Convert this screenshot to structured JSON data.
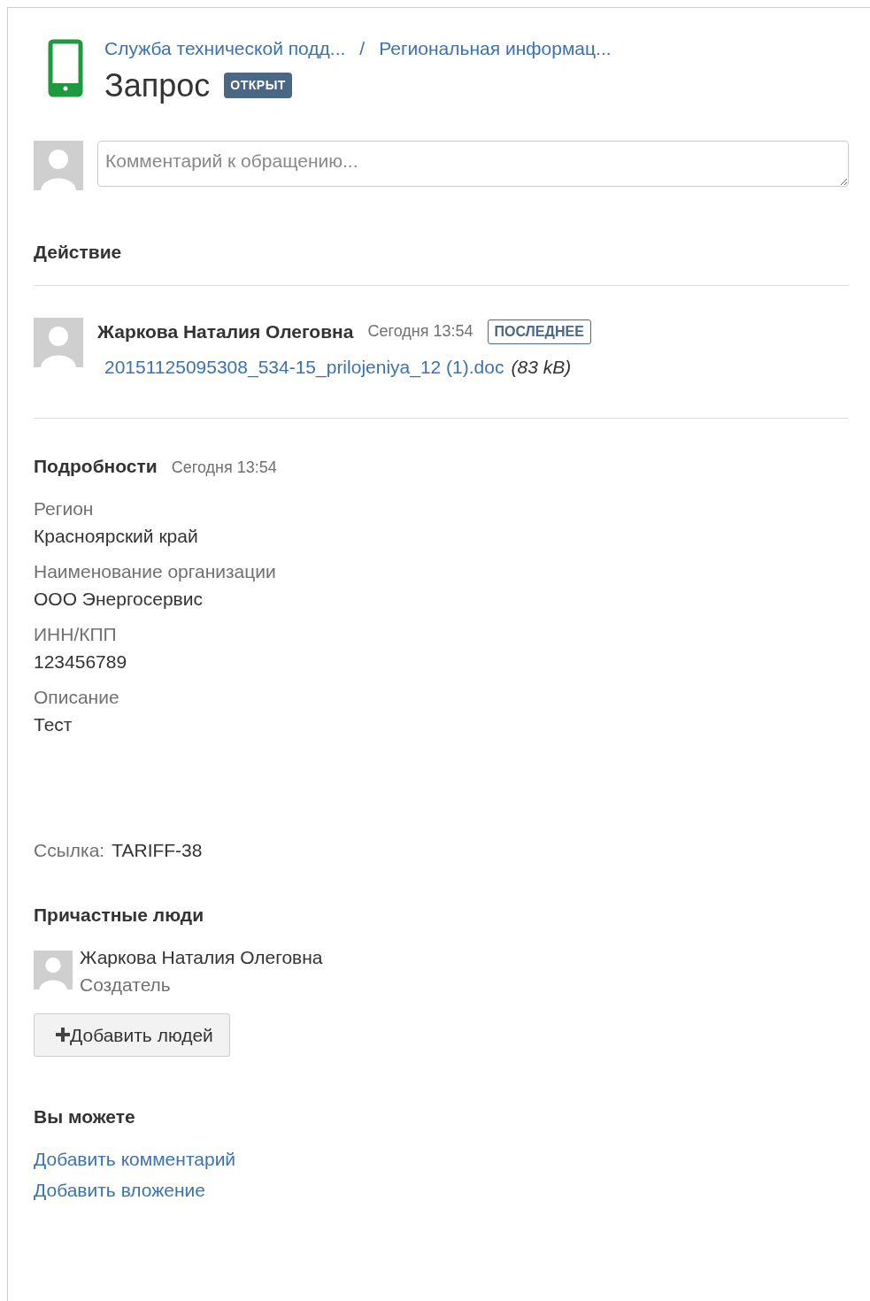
{
  "header": {
    "breadcrumbs": [
      "Служба технической подд...",
      "Региональная информац..."
    ],
    "separator": "/",
    "title": "Запрос",
    "status": "ОТКРЫТ"
  },
  "comment": {
    "placeholder": "Комментарий к обращению..."
  },
  "activity": {
    "heading": "Действие",
    "items": [
      {
        "author": "Жаркова Наталия Олеговна",
        "time": "Сегодня 13:54",
        "tag": "ПОСЛЕДНЕЕ",
        "file": "20151125095308_534-15_prilojeniya_12 (1).doc",
        "size": "(83 kB)"
      }
    ]
  },
  "details": {
    "heading": "Подробности",
    "time": "Сегодня 13:54",
    "fields": [
      {
        "label": "Регион",
        "value": "Красноярский край"
      },
      {
        "label": "Наименование организации",
        "value": "ООО Энергосервис"
      },
      {
        "label": "ИНН/КПП",
        "value": "123456789"
      },
      {
        "label": "Описание",
        "value": "Тест"
      }
    ]
  },
  "reference": {
    "label": "Ссылка:",
    "value": "TARIFF-38"
  },
  "participants": {
    "heading": "Причастные люди",
    "people": [
      {
        "name": "Жаркова Наталия Олеговна",
        "role": "Создатель"
      }
    ],
    "add_button": "Добавить людей"
  },
  "actions": {
    "heading": "Вы можете",
    "links": [
      "Добавить комментарий",
      "Добавить вложение"
    ]
  }
}
